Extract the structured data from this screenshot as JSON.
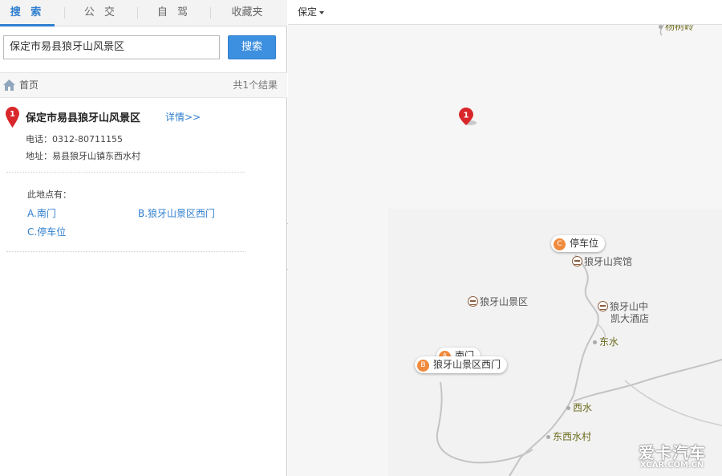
{
  "tabs": [
    {
      "label": "搜 索"
    },
    {
      "label": "公 交"
    },
    {
      "label": "自 驾"
    },
    {
      "label": "收藏夹"
    }
  ],
  "search": {
    "value": "保定市易县狼牙山风景区",
    "button_label": "搜索"
  },
  "breadcrumb": {
    "home_label": "首页",
    "result_count": "共1个结果"
  },
  "result": {
    "index": "1",
    "title": "保定市易县狼牙山风景区",
    "detail_link": "详情>>",
    "phone": "电话：0312-80711155",
    "address": "地址：易县狼牙山镇东西水村",
    "sub_heading": "此地点有：",
    "sub_points": [
      {
        "label": "A.南门"
      },
      {
        "label": "B.狼牙山景区西门"
      },
      {
        "label": "C.停车位"
      }
    ]
  },
  "map": {
    "city": "保定",
    "pin_index": "1",
    "top_label": "杨树岭",
    "callouts": [
      {
        "badge": "C",
        "label": "停车位"
      },
      {
        "badge": "A",
        "label": "南门"
      },
      {
        "badge": "B",
        "label": "狼牙山景区西门"
      }
    ],
    "pois": [
      {
        "label": "狼牙山宾馆"
      },
      {
        "label": "狼牙山景区"
      },
      {
        "label": "狼牙山中"
      },
      {
        "label": "凯大酒店"
      }
    ],
    "villages": [
      {
        "label": "东水"
      },
      {
        "label": "西水"
      },
      {
        "label": "东西水村"
      }
    ]
  },
  "watermark": {
    "main": "爱卡汽车",
    "sub": "XCAR.COM.CN"
  },
  "colors": {
    "accent": "#2f7fcf",
    "pin_red": "#d9262a",
    "callout_badge": "#f08a3c"
  }
}
